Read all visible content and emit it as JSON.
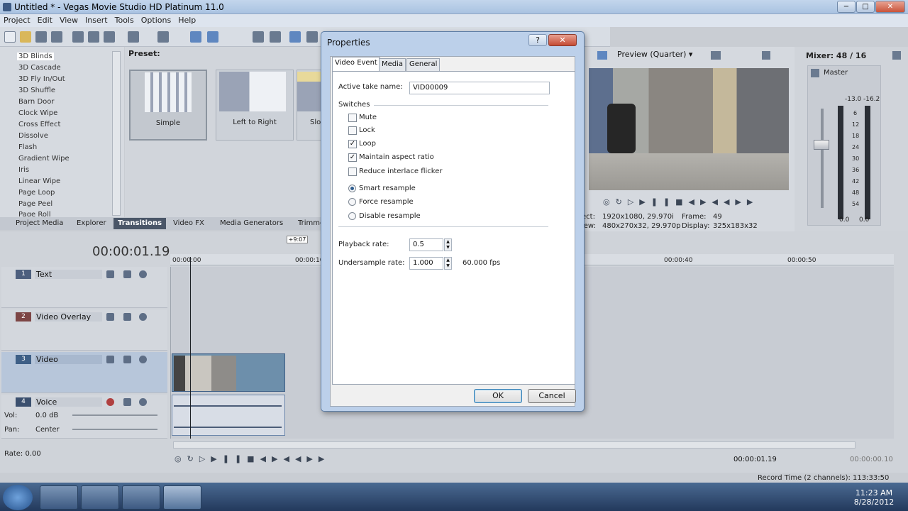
{
  "window": {
    "title": "Untitled * - Vegas Movie Studio HD Platinum 11.0",
    "minimize": "−",
    "maximize": "□",
    "close": "✕"
  },
  "menu": [
    "Project",
    "Edit",
    "View",
    "Insert",
    "Tools",
    "Options",
    "Help"
  ],
  "transitions": {
    "list": [
      "3D Blinds",
      "3D Cascade",
      "3D Fly In/Out",
      "3D Shuffle",
      "Barn Door",
      "Clock Wipe",
      "Cross Effect",
      "Dissolve",
      "Flash",
      "Gradient Wipe",
      "Iris",
      "Linear Wipe",
      "Page Loop",
      "Page Peel",
      "Page Roll"
    ],
    "preset_label": "Preset:",
    "presets": [
      "Simple",
      "Left to Right",
      "Slo"
    ]
  },
  "window_tabs": [
    "Project Media",
    "Explorer",
    "Transitions",
    "Video FX",
    "Media Generators",
    "Trimme"
  ],
  "preview": {
    "mode": "Preview (Quarter)",
    "project_label": "ect:",
    "project_value": "1920x1080, 29.970i",
    "preview_label": "iew:",
    "preview_value": "480x270x32, 29.970p",
    "frame_label": "Frame:",
    "frame_value": "49",
    "display_label": "Display:",
    "display_value": "325x183x32"
  },
  "mixer": {
    "title": "Mixer: 48 / 16",
    "master": "Master",
    "peak_left": "-13.0",
    "peak_right": "-16.2",
    "scale": [
      "6",
      "12",
      "18",
      "24",
      "30",
      "36",
      "42",
      "48",
      "54"
    ],
    "bottom_left": "0.0",
    "bottom_right": "0.0"
  },
  "timeline": {
    "timecode": "00:00:01.19",
    "offset": "+9:07",
    "ruler": [
      "00:00:00",
      "00:00:10",
      "00:00:40",
      "00:00:50"
    ],
    "rate": "Rate: 0.00",
    "tracks": [
      {
        "num": "1",
        "name": "Text"
      },
      {
        "num": "2",
        "name": "Video Overlay"
      },
      {
        "num": "3",
        "name": "Video"
      },
      {
        "num": "4",
        "name": "Voice"
      }
    ],
    "vol_label": "Vol:",
    "vol_value": "0.0 dB",
    "pan_label": "Pan:",
    "pan_value": "Center",
    "cursor_time": "00:00:01.19",
    "end_time": "00:00:00.10",
    "record_time": "Record Time (2 channels): 113:33:50"
  },
  "dialog": {
    "title": "Properties",
    "help": "?",
    "close": "✕",
    "tabs": [
      "Video Event",
      "Media",
      "General"
    ],
    "active_take_label": "Active take name:",
    "active_take_value": "VID00009",
    "switches_label": "Switches",
    "switches": [
      {
        "label": "Mute",
        "checked": false
      },
      {
        "label": "Lock",
        "checked": false
      },
      {
        "label": "Loop",
        "checked": true
      },
      {
        "label": "Maintain aspect ratio",
        "checked": true
      },
      {
        "label": "Reduce interlace flicker",
        "checked": false
      }
    ],
    "resample": [
      {
        "label": "Smart resample",
        "selected": true
      },
      {
        "label": "Force resample",
        "selected": false
      },
      {
        "label": "Disable resample",
        "selected": false
      }
    ],
    "playback_rate_label": "Playback rate:",
    "playback_rate_value": "0.5",
    "undersample_label": "Undersample rate:",
    "undersample_value": "1.000",
    "fps": "60.000 fps",
    "ok": "OK",
    "cancel": "Cancel"
  },
  "taskbar": {
    "time": "11:23 AM",
    "date": "8/28/2012"
  },
  "colors": {
    "track_text": "#4d5f7e",
    "track_overlay": "#7c4545",
    "track_video": "#3e5f86",
    "track_voice": "#3a4f6e",
    "selected_track": "#b7c6da"
  }
}
